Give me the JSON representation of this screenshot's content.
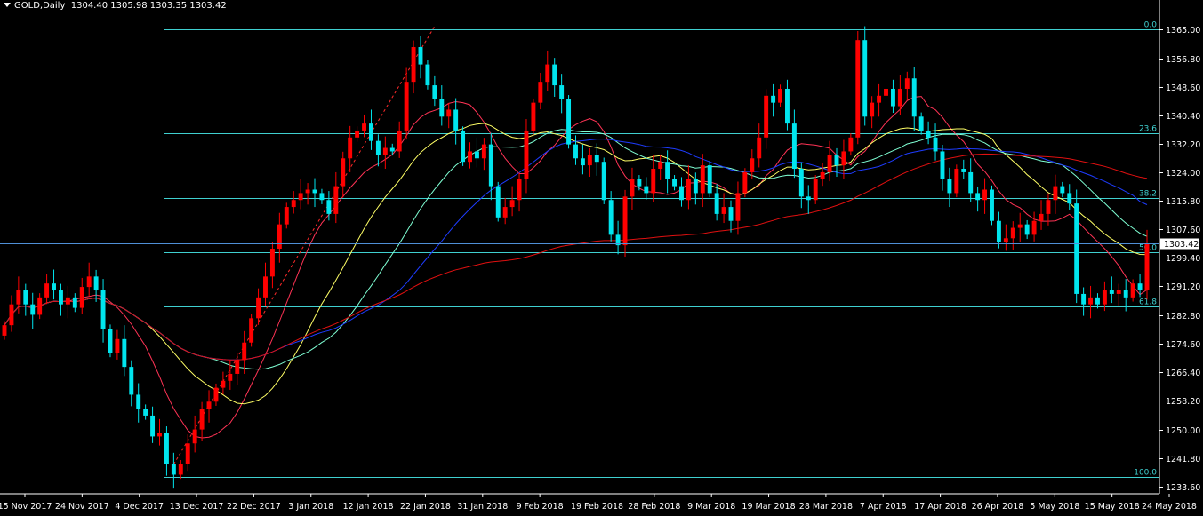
{
  "header": {
    "symbol": "GOLD,Daily",
    "ohlc": "1304.40 1305.98 1303.35 1303.42"
  },
  "colors": {
    "background": "#000000",
    "axis": "#ffffff",
    "bull": "#ff0000",
    "bear": "#00e5ee",
    "fib": "#3fd0d0",
    "ma_fast": "#ff3355",
    "ma_yellow": "#ffff66",
    "ma_aqua": "#7fffd4",
    "ma_blue": "#1e3cff",
    "ma_long": "#e01010",
    "trendline": "#ff2a2a",
    "price_line": "#4f8fd6"
  },
  "chart_data": {
    "type": "candlestick",
    "title": "GOLD,Daily",
    "ylim": [
      1231.5,
      1371.5
    ],
    "y_ticks": [
      "1365.00",
      "1356.80",
      "1348.60",
      "1340.40",
      "1332.20",
      "1324.00",
      "1315.80",
      "1307.60",
      "1299.40",
      "1291.20",
      "1282.80",
      "1274.60",
      "1266.40",
      "1258.20",
      "1250.00",
      "1241.80",
      "1233.60"
    ],
    "x_ticks": [
      "15 Nov 2017",
      "24 Nov 2017",
      "4 Dec 2017",
      "13 Dec 2017",
      "22 Dec 2017",
      "3 Jan 2018",
      "12 Jan 2018",
      "22 Jan 2018",
      "31 Jan 2018",
      "9 Feb 2018",
      "19 Feb 2018",
      "28 Feb 2018",
      "9 Mar 2018",
      "19 Mar 2018",
      "28 Mar 2018",
      "7 Apr 2018",
      "17 Apr 2018",
      "26 Apr 2018",
      "5 May 2018",
      "15 May 2018",
      "24 May 2018"
    ],
    "current_price": "1303.42",
    "fibonacci": [
      {
        "level": "0.0",
        "price": 1365.0
      },
      {
        "level": "23.6",
        "price": 1335.1
      },
      {
        "level": "38.2",
        "price": 1316.5
      },
      {
        "level": "50.0",
        "price": 1301.0
      },
      {
        "level": "61.8",
        "price": 1285.5
      },
      {
        "level": "100.0",
        "price": 1236.3
      }
    ],
    "closes": [
      1280,
      1286,
      1290,
      1286,
      1283,
      1288,
      1292,
      1290,
      1286,
      1288,
      1285,
      1291,
      1294,
      1290,
      1279,
      1272,
      1276,
      1268,
      1260,
      1256,
      1254,
      1248,
      1249,
      1240,
      1237,
      1240,
      1246,
      1250,
      1256,
      1258,
      1262,
      1264,
      1266,
      1270,
      1275,
      1282,
      1288,
      1294,
      1302,
      1309,
      1314,
      1316,
      1318,
      1319,
      1318,
      1316,
      1312,
      1320,
      1328,
      1334,
      1336,
      1338,
      1333,
      1329,
      1331,
      1330,
      1336,
      1350,
      1360,
      1355,
      1349,
      1345,
      1340,
      1342,
      1336,
      1327,
      1330,
      1328,
      1332,
      1320,
      1311,
      1314,
      1316,
      1322,
      1336,
      1344,
      1350,
      1355,
      1349,
      1345,
      1332,
      1328,
      1326,
      1329,
      1327,
      1316,
      1306,
      1303,
      1317,
      1322,
      1320,
      1318,
      1325,
      1327,
      1322,
      1320,
      1316,
      1322,
      1318,
      1326,
      1318,
      1312,
      1314,
      1310,
      1318,
      1324,
      1328,
      1334,
      1346,
      1344,
      1348,
      1338,
      1325,
      1317,
      1316,
      1322,
      1324,
      1329,
      1326,
      1330,
      1334,
      1362,
      1340,
      1344,
      1346,
      1348,
      1343,
      1348,
      1351,
      1340,
      1336,
      1334,
      1330,
      1322,
      1318,
      1325,
      1324,
      1318,
      1316,
      1319,
      1310,
      1304,
      1305,
      1308,
      1309,
      1306,
      1310,
      1312,
      1316,
      1320,
      1318,
      1315,
      1289,
      1286,
      1288,
      1286,
      1290,
      1289,
      1290,
      1288,
      1292,
      1290,
      1303.42
    ],
    "moving_averages": [
      {
        "period": 10,
        "color_key": "ma_fast"
      },
      {
        "period": 20,
        "color_key": "ma_yellow"
      },
      {
        "period": 30,
        "color_key": "ma_aqua"
      },
      {
        "period": 40,
        "color_key": "ma_blue"
      },
      {
        "period": 100,
        "color_key": "ma_long"
      }
    ],
    "trendline": {
      "from_index": 24,
      "from_price": 1240,
      "to_index": 61,
      "to_price": 1366
    }
  }
}
